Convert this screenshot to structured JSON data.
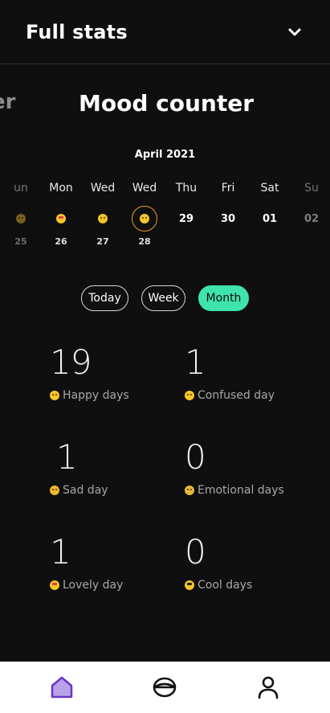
{
  "header": {
    "title": "Full stats"
  },
  "counter": {
    "prev_label": "nter",
    "current_label": "Mood counter"
  },
  "calendar": {
    "month_label": "April 2021",
    "days": [
      {
        "name": "un",
        "slot": "",
        "num": "25",
        "mood": "happy",
        "faded": true
      },
      {
        "name": "Mon",
        "slot": "",
        "num": "26",
        "mood": "love",
        "faded": false
      },
      {
        "name": "Wed",
        "slot": "",
        "num": "27",
        "mood": "confused",
        "faded": false
      },
      {
        "name": "Wed",
        "slot": "",
        "num": "28",
        "mood": "happy",
        "faded": false,
        "selected": true
      },
      {
        "name": "Thu",
        "slot": "29",
        "num": "",
        "mood": "",
        "faded": false
      },
      {
        "name": "Fri",
        "slot": "30",
        "num": "",
        "mood": "",
        "faded": false
      },
      {
        "name": "Sat",
        "slot": "01",
        "num": "",
        "mood": "",
        "faded": false
      },
      {
        "name": "Su",
        "slot": "02",
        "num": "",
        "mood": "",
        "faded": true
      }
    ]
  },
  "filters": {
    "today": "Today",
    "week": "Week",
    "month": "Month",
    "active": "month"
  },
  "stats": {
    "happy": {
      "num": "19",
      "label": "Happy days"
    },
    "confused": {
      "num": "1",
      "label": "Confused day"
    },
    "sad": {
      "num": "1",
      "label": "Sad day"
    },
    "emotional": {
      "num": "0",
      "label": "Emotional days"
    },
    "lovely": {
      "num": "1",
      "label": "Lovely day"
    },
    "cool": {
      "num": "0",
      "label": "Cool days"
    }
  },
  "nav": {
    "items": [
      "home-icon",
      "bowl-icon",
      "profile-icon"
    ]
  },
  "colors": {
    "accent": "#3fe3ae",
    "background": "#0f0f10",
    "nav_active": "#6a35c9",
    "selected_ring": "#e89a2a"
  }
}
